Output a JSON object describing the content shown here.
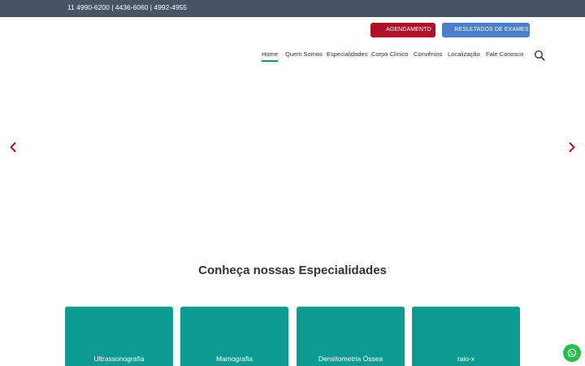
{
  "topbar": {
    "phones": "11 4990-6200 | 4436-6060 | 4992-4955"
  },
  "header": {
    "agendamento_label": "AGENDAMENTO",
    "resultados_label": "RESULTADOS DE EXAMES"
  },
  "nav": {
    "items": [
      {
        "label": "Home",
        "active": true
      },
      {
        "label": "Quem Somos"
      },
      {
        "label": "Especialidades"
      },
      {
        "label": "Corpo Clínico"
      },
      {
        "label": "Convênios"
      },
      {
        "label": "Localização"
      },
      {
        "label": "Fale Conosco"
      }
    ]
  },
  "main": {
    "section_title": "Conheça nossas Especialidades",
    "cards": [
      {
        "label": "Ultrassonografia"
      },
      {
        "label": "Mamografia"
      },
      {
        "label": "Densitometria Óssea"
      },
      {
        "label": "raio-x"
      }
    ]
  },
  "colors": {
    "topbar": "#465466",
    "agendamento": "#b0112a",
    "resultados": "#4a7ec8",
    "card": "#0b9b91",
    "accent": "#0b9688",
    "arrow": "#b0112a",
    "whatsapp": "#25c04a"
  },
  "icons": {
    "search": "search-icon",
    "prev": "chevron-left-icon",
    "next": "chevron-right-icon",
    "whatsapp": "whatsapp-icon"
  }
}
